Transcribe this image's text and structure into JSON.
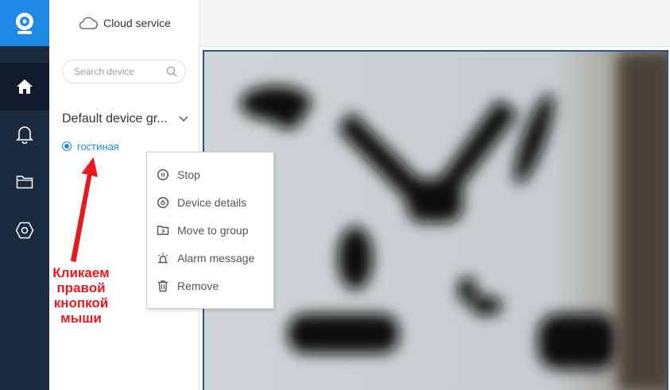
{
  "sidebar": {
    "cloud_label": "Cloud service",
    "search_placeholder": "Search device",
    "group_label": "Default device gr...",
    "device_name": "гостиная"
  },
  "nav": {
    "items": [
      {
        "icon": "home-icon",
        "active": true
      },
      {
        "icon": "bell-icon",
        "active": false
      },
      {
        "icon": "folder-icon",
        "active": false
      },
      {
        "icon": "hexagon-settings-icon",
        "active": false
      }
    ]
  },
  "context_menu": {
    "items": [
      {
        "label": "Stop",
        "icon": "stop-icon"
      },
      {
        "label": "Device details",
        "icon": "details-icon"
      },
      {
        "label": "Move to group",
        "icon": "move-folder-icon"
      },
      {
        "label": "Alarm message",
        "icon": "alarm-icon"
      },
      {
        "label": "Remove",
        "icon": "trash-icon"
      }
    ]
  },
  "annotation": {
    "lines": [
      "Кликаем",
      "правой",
      "кнопкой",
      "мыши"
    ]
  },
  "colors": {
    "accent": "#1e88e5",
    "rail": "#1b2b3f",
    "annotation": "#e8191d"
  }
}
